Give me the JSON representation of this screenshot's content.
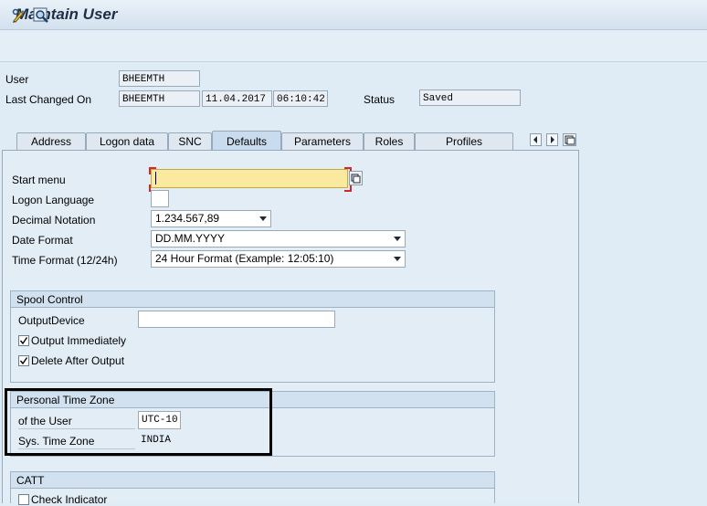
{
  "window": {
    "title": "Maintain User"
  },
  "header": {
    "user_label": "User",
    "user_value": "BHEEMTH",
    "last_changed_label": "Last Changed On",
    "last_changed_user": "BHEEMTH",
    "last_changed_date": "11.04.2017",
    "last_changed_time": "06:10:42",
    "status_label": "Status",
    "status_value": "Saved"
  },
  "tabs": [
    {
      "label": "Address"
    },
    {
      "label": "Logon data"
    },
    {
      "label": "SNC"
    },
    {
      "label": "Defaults"
    },
    {
      "label": "Parameters"
    },
    {
      "label": "Roles"
    },
    {
      "label": "Profiles"
    }
  ],
  "defaults": {
    "start_menu_label": "Start menu",
    "start_menu_value": "",
    "logon_language_label": "Logon Language",
    "logon_language_value": "",
    "decimal_notation_label": "Decimal Notation",
    "decimal_notation_value": "1.234.567,89",
    "date_format_label": "Date Format",
    "date_format_value": "DD.MM.YYYY",
    "time_format_label": "Time Format (12/24h)",
    "time_format_value": "24 Hour Format (Example: 12:05:10)"
  },
  "spool": {
    "title": "Spool Control",
    "output_device_label": "OutputDevice",
    "output_device_value": "",
    "output_immediately_label": "Output Immediately",
    "output_immediately_checked": true,
    "delete_after_output_label": "Delete After Output",
    "delete_after_output_checked": true
  },
  "timezone": {
    "title": "Personal Time Zone",
    "of_user_label": "of the User",
    "of_user_value": "UTC-10",
    "sys_tz_label": "Sys. Time Zone",
    "sys_tz_value": "INDIA"
  },
  "catt": {
    "title": "CATT",
    "check_indicator_label": "Check Indicator",
    "check_indicator_checked": false
  },
  "colors": {
    "required_field_bg": "#fbe9a0",
    "highlight_box": "#000000"
  }
}
